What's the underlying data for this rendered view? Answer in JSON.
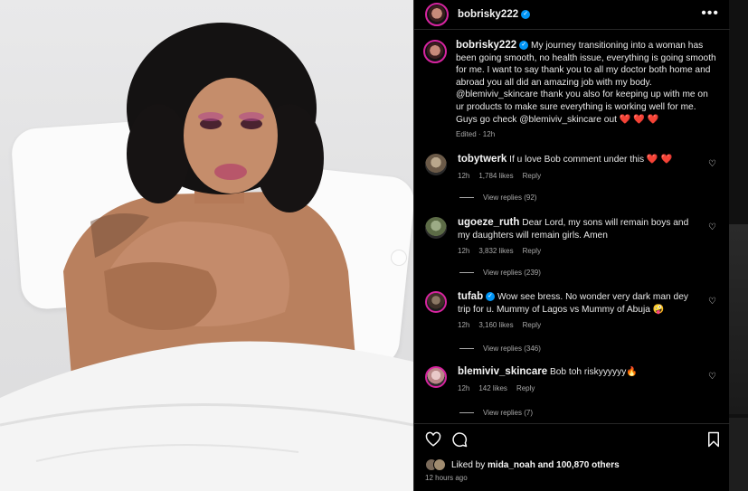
{
  "post": {
    "username": "bobrisky222",
    "verified": true,
    "caption": "My journey transitioning into a woman has been going smooth, no health issue, everything is going smooth for me. I want to say thank you to all my doctor both home and abroad you all did an amazing job with my body. @blemiviv_skincare thank you also for keeping up with me on ur products to make sure everything is working well for me. Guys go check @blemiviv_skincare out ❤️ ❤️ ❤️",
    "caption_meta": "Edited · 12h"
  },
  "comments": [
    {
      "username": "tobytwerk",
      "text": "If u love Bob comment under this ❤️ ❤️",
      "time": "12h",
      "likes": "1,784 likes",
      "reply": "Reply",
      "view_replies": "View replies (92)"
    },
    {
      "username": "ugoeze_ruth",
      "text": "Dear Lord, my sons will remain boys and my daughters will remain girls. Amen",
      "time": "12h",
      "likes": "3,832 likes",
      "reply": "Reply",
      "view_replies": "View replies (239)"
    },
    {
      "username": "tufab",
      "verified": true,
      "text": "Wow see bress. No wonder very dark man dey trip for u. Mummy of Lagos vs Mummy of Abuja 🤪",
      "time": "12h",
      "likes": "3,160 likes",
      "reply": "Reply",
      "view_replies": "View replies (346)"
    },
    {
      "username": "blemiviv_skincare",
      "text": "Bob toh riskyyyyyy🔥",
      "time": "12h",
      "likes": "142 likes",
      "reply": "Reply",
      "view_replies": "View replies (7)"
    }
  ],
  "actions": {
    "liked_by_prefix": "Liked by",
    "liked_by_user": "mida_noah",
    "liked_by_suffix": "and 100,870 others",
    "timestamp": "12 hours ago"
  },
  "icons": {
    "more": "more-horizontal-icon",
    "like": "heart-icon",
    "comment": "comment-icon",
    "save": "bookmark-icon"
  },
  "colors": {
    "background": "#000000",
    "verified": "#0095f6",
    "story_ring": "#d6249f",
    "secondary_text": "#a8a8a8"
  }
}
